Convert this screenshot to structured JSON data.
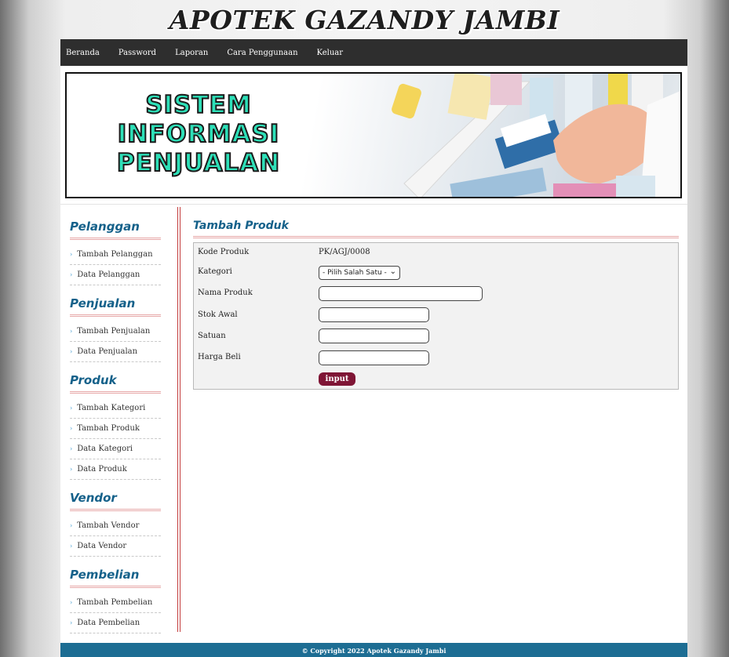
{
  "site": {
    "title": "APOTEK GAZANDY JAMBI"
  },
  "nav": {
    "items": [
      "Beranda",
      "Password",
      "Laporan",
      "Cara Penggunaan",
      "Keluar"
    ]
  },
  "banner": {
    "lines": [
      "SISTEM",
      "INFORMASI",
      "PENJUALAN"
    ]
  },
  "sidebar": {
    "sections": [
      {
        "title": "Pelanggan",
        "links": [
          "Tambah Pelanggan",
          "Data Pelanggan"
        ]
      },
      {
        "title": "Penjualan",
        "links": [
          "Tambah Penjualan",
          "Data Penjualan"
        ]
      },
      {
        "title": "Produk",
        "links": [
          "Tambah Kategori",
          "Tambah Produk",
          "Data Kategori",
          "Data Produk"
        ]
      },
      {
        "title": "Vendor",
        "links": [
          "Tambah Vendor",
          "Data Vendor"
        ]
      },
      {
        "title": "Pembelian",
        "links": [
          "Tambah Pembelian",
          "Data Pembelian"
        ]
      }
    ]
  },
  "form": {
    "title": "Tambah Produk",
    "kode_label": "Kode Produk",
    "kode_value": "PK/AGJ/0008",
    "kategori_label": "Kategori",
    "kategori_selected": "- Pilih Salah Satu -",
    "nama_label": "Nama Produk",
    "nama_value": "",
    "stok_label": "Stok Awal",
    "stok_value": "",
    "satuan_label": "Satuan",
    "satuan_value": "",
    "harga_label": "Harga Beli",
    "harga_value": "",
    "submit_label": "input"
  },
  "footer": {
    "text": "© Copyright 2022 Apotek Gazandy Jambi"
  },
  "colors": {
    "nav_bg": "#2e2e2e",
    "heading": "#15618a",
    "button": "#7f1535",
    "footer": "#1d6d93",
    "banner_text": "#2de0b8"
  }
}
